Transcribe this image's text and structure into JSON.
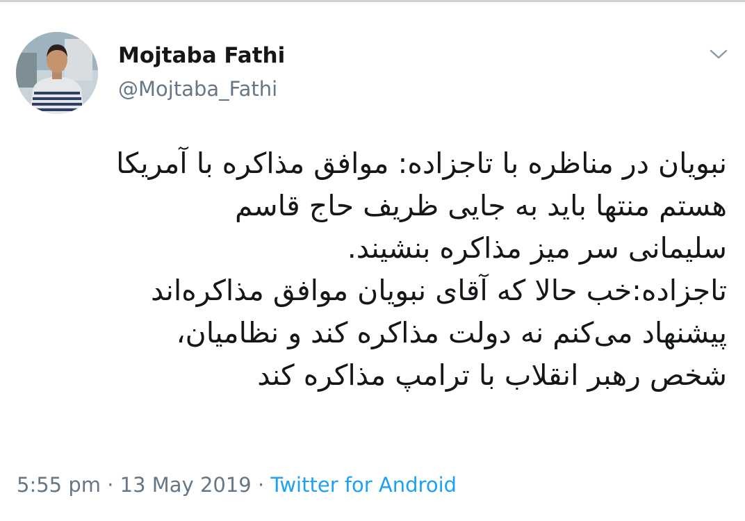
{
  "tweet": {
    "author": {
      "display_name": "Mojtaba Fathi",
      "handle": "@Mojtaba_Fathi"
    },
    "caret_icon": "chevron-down-icon",
    "text_lines": [
      "نبویان در مناظره با تاجزاده: موافق مذاکره با آمریکا",
      "هستم منتها باید به جایی ظریف حاج قاسم",
      "سلیمانی سر میز مذاکره بنشیند.",
      "تاجزاده:خب حالا که آقای نبویان موافق مذاکره‌اند",
      "پیشنهاد می‌کنم نه دولت مذاکره کند و نظامیان،",
      "شخص رهبر انقلاب با ترامپ مذاکره کند"
    ],
    "meta": {
      "time": "5:55 pm",
      "separator": "·",
      "date": "13 May 2019",
      "source": "Twitter for Android"
    }
  },
  "colors": {
    "text": "#14171a",
    "secondary": "#657786",
    "link": "#1da1f2"
  }
}
